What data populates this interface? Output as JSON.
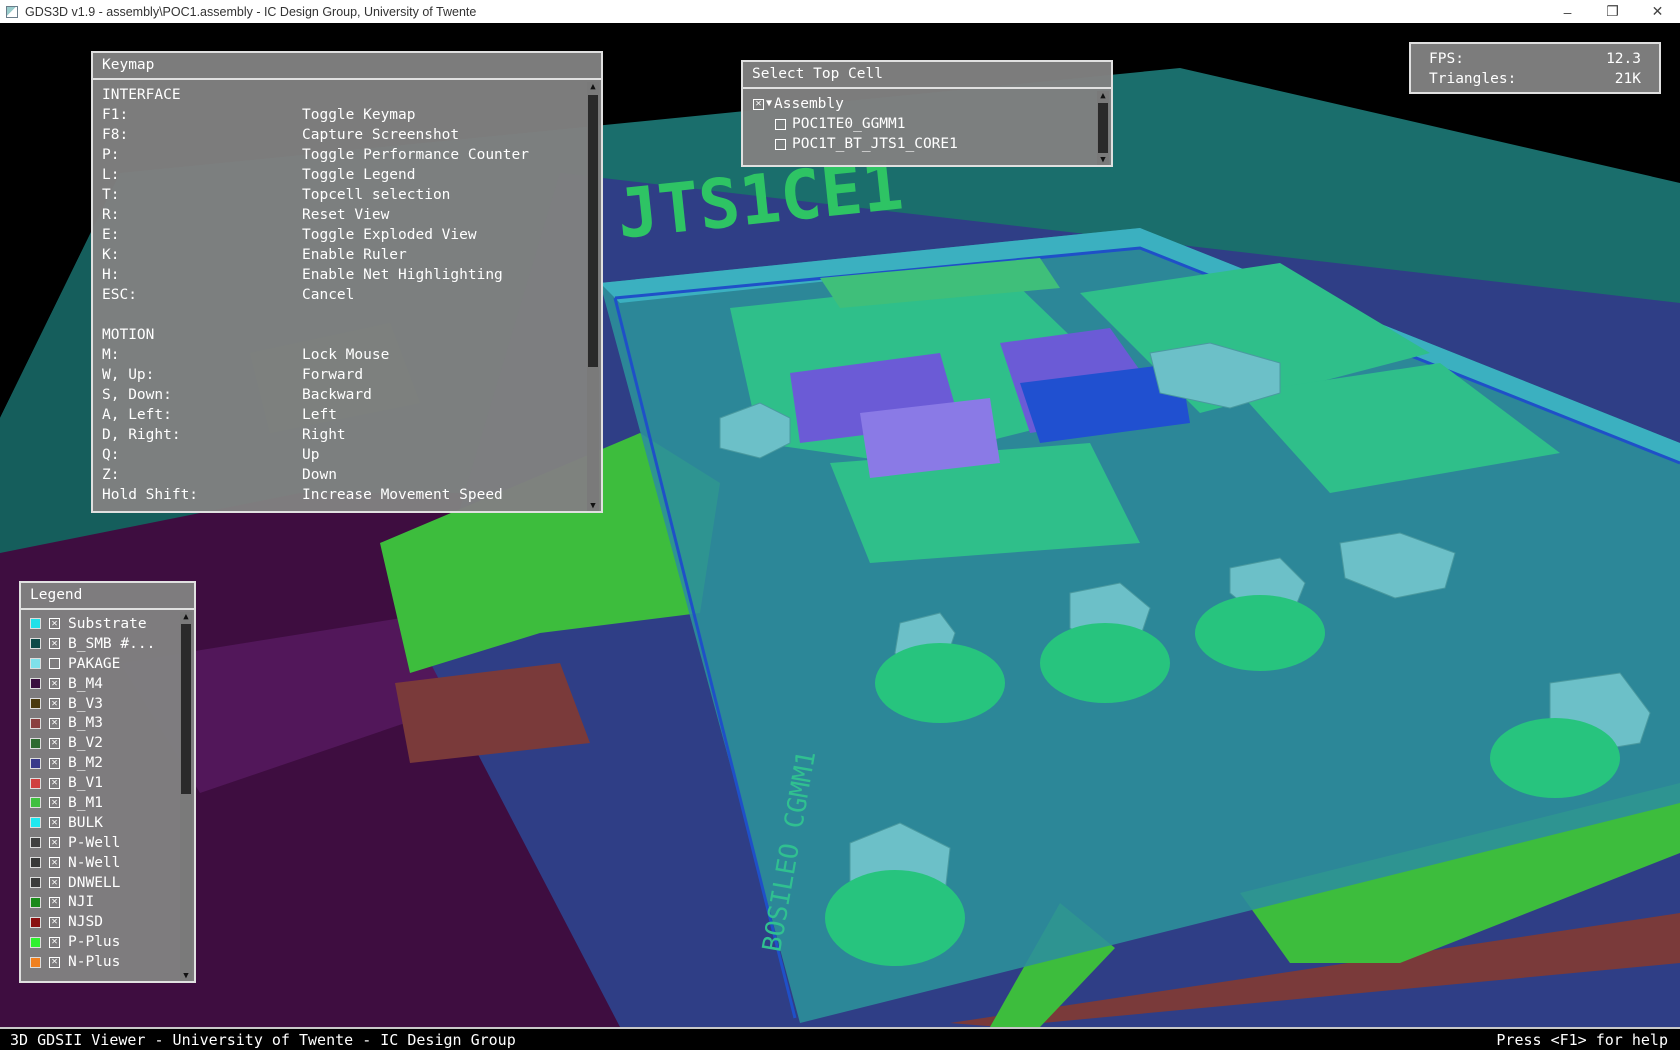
{
  "window": {
    "title": "GDS3D v1.9  -  assembly\\POC1.assembly  -  IC Design Group, University of Twente",
    "minimize_icon": "minimize-icon",
    "restore_icon": "restore-icon",
    "close_icon": "close-icon"
  },
  "keymap": {
    "title": "Keymap",
    "lines": [
      {
        "key": "INTERFACE",
        "action": ""
      },
      {
        "key": "F1:",
        "action": "Toggle Keymap"
      },
      {
        "key": "F8:",
        "action": "Capture Screenshot"
      },
      {
        "key": "P:",
        "action": "Toggle Performance Counter"
      },
      {
        "key": "L:",
        "action": "Toggle Legend"
      },
      {
        "key": "T:",
        "action": "Topcell selection"
      },
      {
        "key": "R:",
        "action": "Reset View"
      },
      {
        "key": "E:",
        "action": "Toggle Exploded View"
      },
      {
        "key": "K:",
        "action": "Enable Ruler"
      },
      {
        "key": "H:",
        "action": "Enable Net Highlighting"
      },
      {
        "key": "ESC:",
        "action": "Cancel"
      },
      {
        "key": "",
        "action": ""
      },
      {
        "key": "MOTION",
        "action": ""
      },
      {
        "key": "M:",
        "action": "Lock Mouse"
      },
      {
        "key": "W, Up:",
        "action": "Forward"
      },
      {
        "key": "S, Down:",
        "action": "Backward"
      },
      {
        "key": "A, Left:",
        "action": "Left"
      },
      {
        "key": "D, Right:",
        "action": "Right"
      },
      {
        "key": "Q:",
        "action": "Up"
      },
      {
        "key": "Z:",
        "action": "Down"
      },
      {
        "key": "Hold Shift:",
        "action": "Increase Movement Speed"
      }
    ]
  },
  "top_cell": {
    "title": "Select Top Cell",
    "items": [
      {
        "label": "Assembly",
        "checked": true,
        "expanded": true,
        "indent": 0
      },
      {
        "label": "POC1TE0_GGMM1",
        "checked": false,
        "indent": 1
      },
      {
        "label": "POC1T_BT_JTS1_CORE1",
        "checked": false,
        "indent": 1
      }
    ]
  },
  "performance": {
    "fps_label": "FPS:",
    "fps_value": "12.3",
    "triangles_label": "Triangles:",
    "triangles_value": "21K"
  },
  "legend": {
    "title": "Legend",
    "layers": [
      {
        "name": "Substrate",
        "color": "#22e0e8",
        "checked": true
      },
      {
        "name": "B_SMB #...",
        "color": "#0e4a48",
        "checked": true
      },
      {
        "name": "PAKAGE",
        "color": "#7fe0ea",
        "checked": false
      },
      {
        "name": "B_M4",
        "color": "#3a0f3e",
        "checked": true
      },
      {
        "name": "B_V3",
        "color": "#4a3a10",
        "checked": true
      },
      {
        "name": "B_M3",
        "color": "#8a4040",
        "checked": true
      },
      {
        "name": "B_V2",
        "color": "#2e6a30",
        "checked": true
      },
      {
        "name": "B_M2",
        "color": "#3a3a8a",
        "checked": true
      },
      {
        "name": "B_V1",
        "color": "#d04040",
        "checked": true
      },
      {
        "name": "B_M1",
        "color": "#40c040",
        "checked": true
      },
      {
        "name": "BULK",
        "color": "#20e8f0",
        "checked": true
      },
      {
        "name": "P-Well",
        "color": "#404040",
        "checked": true
      },
      {
        "name": "N-Well",
        "color": "#383838",
        "checked": true
      },
      {
        "name": "DNWELL",
        "color": "#3c3c3c",
        "checked": true
      },
      {
        "name": "NJI",
        "color": "#1a8a1a",
        "checked": true
      },
      {
        "name": "NJSD",
        "color": "#8a1010",
        "checked": true
      },
      {
        "name": "P-Plus",
        "color": "#30f030",
        "checked": true
      },
      {
        "name": "N-Plus",
        "color": "#f08020",
        "checked": true
      }
    ]
  },
  "status": {
    "left": "3D GDSII Viewer - University of Twente - IC Design Group",
    "right": "Press <F1> for help"
  },
  "scene": {
    "chip_text_top": "JTS1CE1",
    "chip_text_side": "BOSILEO CGMM1"
  }
}
